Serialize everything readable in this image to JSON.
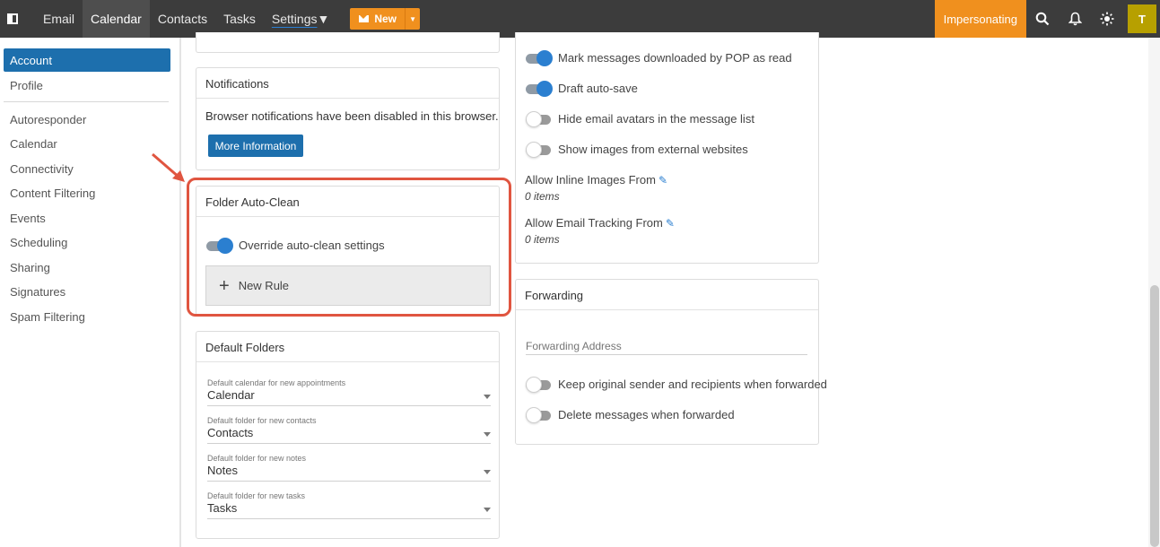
{
  "topbar": {
    "nav": [
      "Email",
      "Calendar",
      "Contacts",
      "Tasks",
      "Settings"
    ],
    "new_label": "New",
    "impersonating": "Impersonating",
    "avatar_letter": "T",
    "accent": "#f0901e"
  },
  "sidebar": {
    "active": "Account",
    "items": [
      "Profile",
      "Autoresponder",
      "Calendar",
      "Connectivity",
      "Content Filtering",
      "Events",
      "Scheduling",
      "Sharing",
      "Signatures",
      "Spam Filtering"
    ]
  },
  "notifications": {
    "title": "Notifications",
    "message": "Browser notifications have been disabled in this browser.",
    "button": "More Information"
  },
  "auto_clean": {
    "title": "Folder Auto-Clean",
    "toggle_label": "Override auto-clean settings",
    "toggle_on": true,
    "new_rule": "New Rule",
    "highlight_color": "#e05540"
  },
  "default_folders": {
    "title": "Default Folders",
    "fields": [
      {
        "label": "Default calendar for new appointments",
        "value": "Calendar"
      },
      {
        "label": "Default folder for new contacts",
        "value": "Contacts"
      },
      {
        "label": "Default folder for new notes",
        "value": "Notes"
      },
      {
        "label": "Default folder for new tasks",
        "value": "Tasks"
      }
    ]
  },
  "options": {
    "toggles": [
      {
        "label": "Mark messages downloaded by POP as read",
        "on": true
      },
      {
        "label": "Draft auto-save",
        "on": true
      },
      {
        "label": "Hide email avatars in the message list",
        "on": false
      },
      {
        "label": "Show images from external websites",
        "on": false
      }
    ],
    "inline_images_label": "Allow Inline Images From",
    "inline_images_value": "0 items",
    "tracking_label": "Allow Email Tracking From",
    "tracking_value": "0 items"
  },
  "forwarding": {
    "title": "Forwarding",
    "address_placeholder": "Forwarding Address",
    "toggles": [
      {
        "label": "Keep original sender and recipients when forwarded",
        "on": false
      },
      {
        "label": "Delete messages when forwarded",
        "on": false
      }
    ]
  }
}
